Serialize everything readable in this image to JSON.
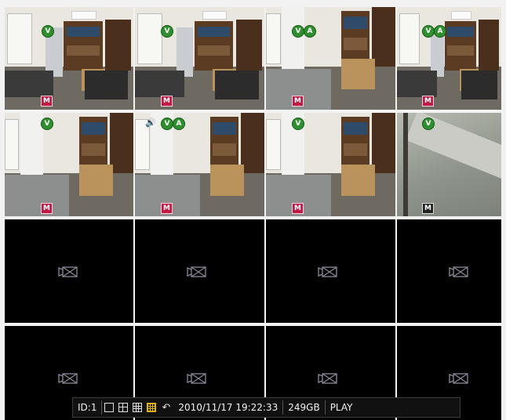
{
  "status_bar": {
    "id_label": "ID:1",
    "datetime": "2010/11/17 19:22:33",
    "storage": "249GB",
    "mode": "PLAY"
  },
  "badges": {
    "video": "V",
    "audio": "A",
    "motion": "M"
  }
}
